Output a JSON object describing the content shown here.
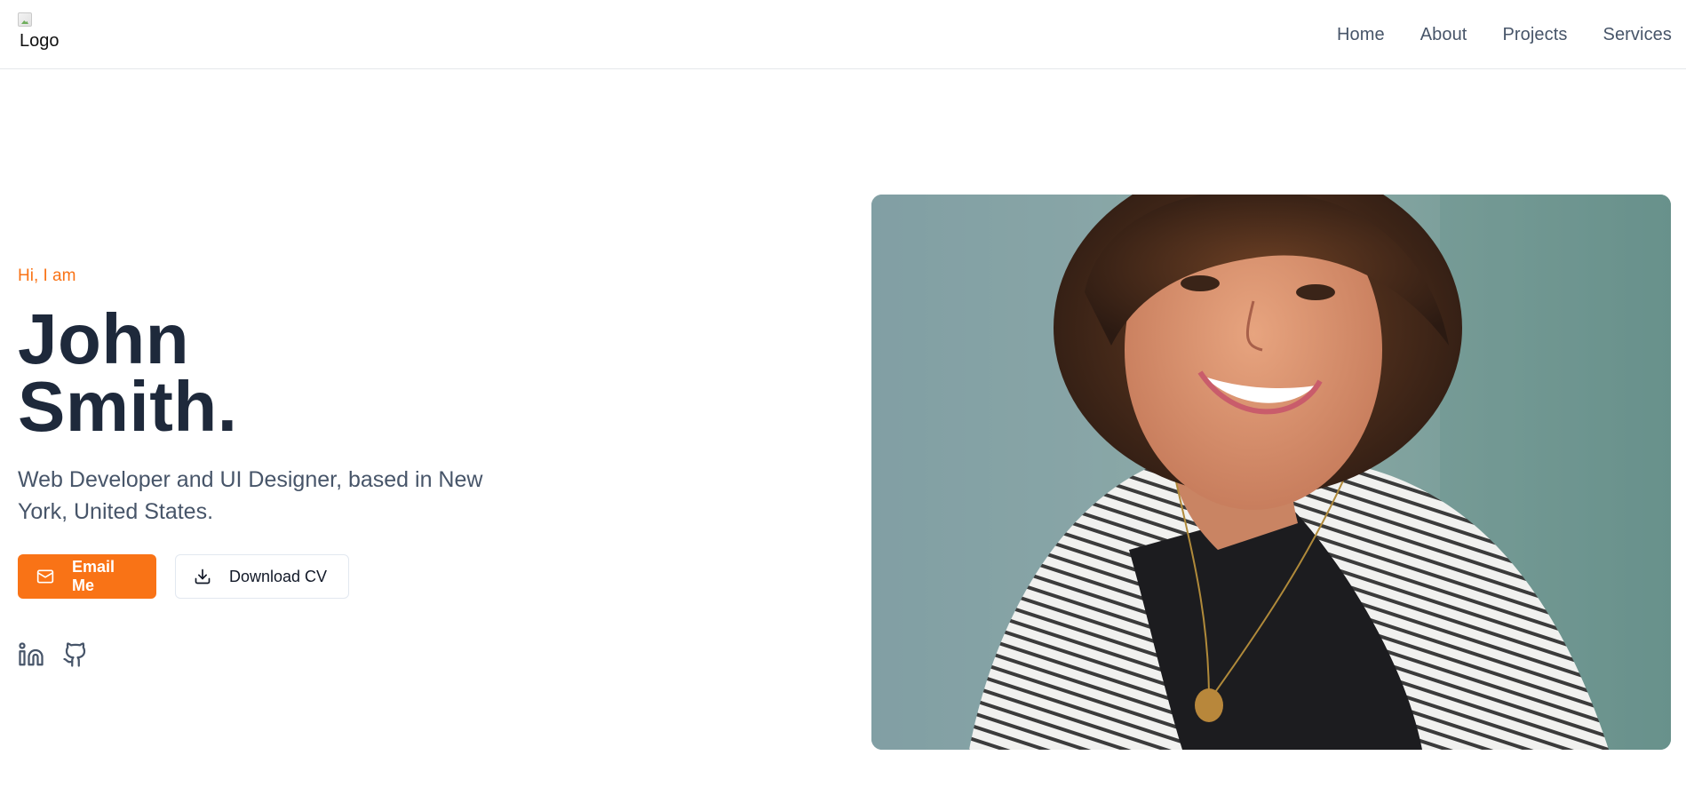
{
  "header": {
    "logo_alt": "Logo",
    "nav": [
      "Home",
      "About",
      "Projects",
      "Services"
    ]
  },
  "hero": {
    "greeting": "Hi, I am",
    "name_line1": "John",
    "name_line2": "Smith.",
    "tagline": "Web Developer and UI Designer, based in New York, United States.",
    "email_button": "Email Me",
    "cv_button": "Download CV",
    "email_icon": "mail-icon",
    "cv_icon": "download-icon",
    "socials": [
      "linkedin-icon",
      "github-icon"
    ]
  },
  "photo": {
    "subject": "portrait"
  },
  "colors": {
    "accent": "#f97316",
    "heading": "#1e293b",
    "text_muted": "#475569",
    "border": "#e5e7eb"
  }
}
